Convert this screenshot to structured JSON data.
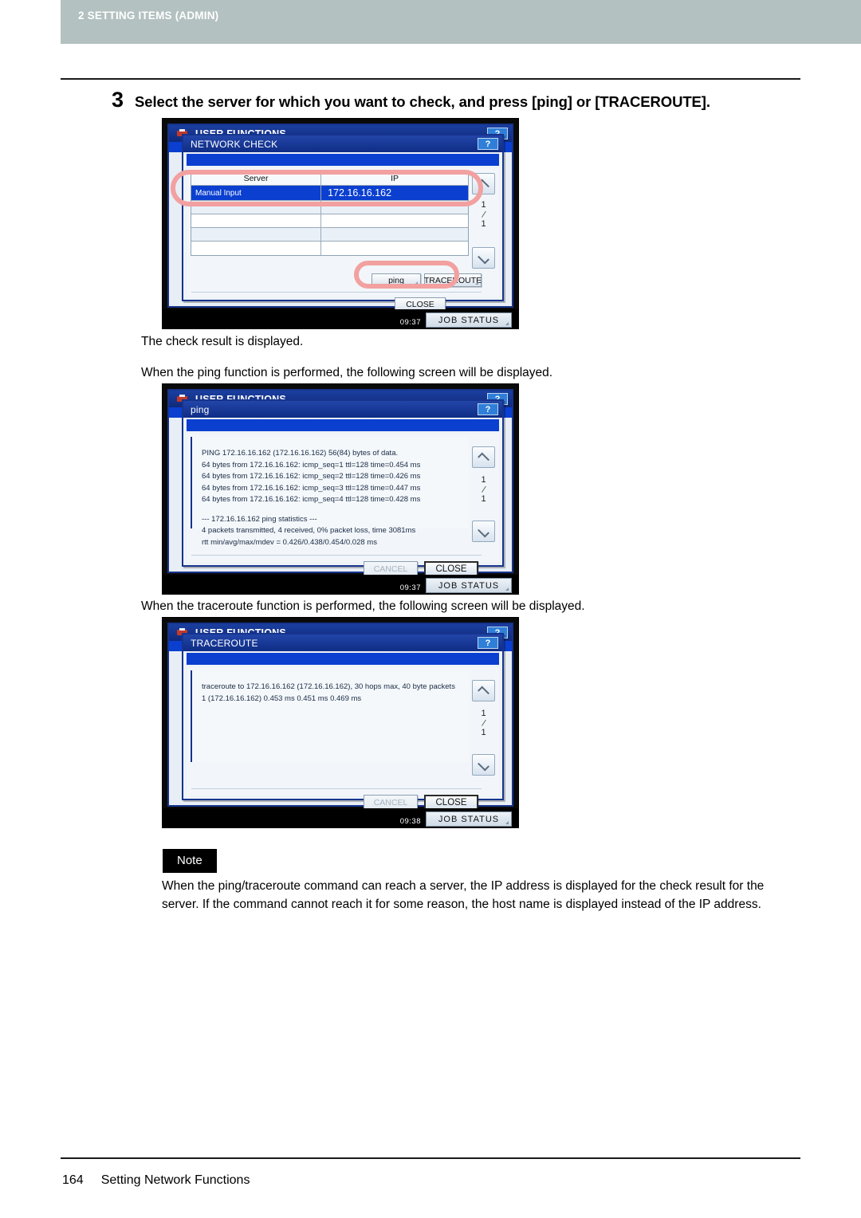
{
  "header": {
    "running_head": "2 SETTING ITEMS (ADMIN)"
  },
  "step": {
    "number": "3",
    "text": "Select the server for which you want to check, and press [ping] or [TRACEROUTE]."
  },
  "paragraphs": {
    "after_step1": "The check result is displayed.",
    "before_ping": "When the ping function is performed, the following screen will be displayed.",
    "before_traceroute": "When the traceroute function is performed, the following screen will be displayed."
  },
  "screens": {
    "network_check": {
      "app_title": "USER FUNCTIONS",
      "help_label": "?",
      "dialog_title": "NETWORK CHECK",
      "table": {
        "columns": [
          "Server",
          "IP"
        ],
        "rows": [
          {
            "server": "Manual Input",
            "ip": "172.16.16.162",
            "selected": true
          },
          {
            "server": "",
            "ip": "",
            "selected": false
          },
          {
            "server": "",
            "ip": "",
            "selected": false
          },
          {
            "server": "",
            "ip": "",
            "selected": false
          },
          {
            "server": "",
            "ip": "",
            "selected": false
          }
        ]
      },
      "pager": {
        "current": "1",
        "total": "1"
      },
      "buttons": {
        "ping": "ping",
        "traceroute": "TRACEROUTE",
        "close": "CLOSE"
      },
      "status_bar": {
        "clock": "09:37",
        "job_status": "JOB STATUS"
      }
    },
    "ping": {
      "app_title": "USER FUNCTIONS",
      "help_label": "?",
      "dialog_title": "ping",
      "log": [
        "PING 172.16.16.162 (172.16.16.162) 56(84) bytes of data.",
        "64 bytes from 172.16.16.162: icmp_seq=1 ttl=128 time=0.454 ms",
        "64 bytes from 172.16.16.162: icmp_seq=2 ttl=128 time=0.426 ms",
        "64 bytes from 172.16.16.162: icmp_seq=3 ttl=128 time=0.447 ms",
        "64 bytes from 172.16.16.162: icmp_seq=4 ttl=128 time=0.428 ms",
        "",
        "--- 172.16.16.162 ping statistics ---",
        "4 packets transmitted, 4 received, 0% packet loss, time 3081ms",
        "rtt min/avg/max/mdev = 0.426/0.438/0.454/0.028 ms"
      ],
      "pager": {
        "current": "1",
        "total": "1"
      },
      "buttons": {
        "cancel": "CANCEL",
        "close": "CLOSE"
      },
      "status_bar": {
        "clock": "09:37",
        "job_status": "JOB STATUS"
      }
    },
    "traceroute": {
      "app_title": "USER FUNCTIONS",
      "help_label": "?",
      "dialog_title": "TRACEROUTE",
      "log": [
        "traceroute to 172.16.16.162 (172.16.16.162), 30 hops max, 40 byte packets",
        " 1  (172.16.16.162)  0.453 ms  0.451 ms  0.469 ms"
      ],
      "pager": {
        "current": "1",
        "total": "1"
      },
      "buttons": {
        "cancel": "CANCEL",
        "close": "CLOSE"
      },
      "status_bar": {
        "clock": "09:38",
        "job_status": "JOB STATUS"
      }
    }
  },
  "note": {
    "label": "Note",
    "line1": "When the ping/traceroute command can reach a server, the IP address is displayed for the check result for the",
    "line2": "server. If the command cannot reach it for some reason, the host name is displayed instead of the IP address."
  },
  "footer": {
    "page_number": "164",
    "title": "Setting Network Functions"
  },
  "colors": {
    "header_band": "#b3c1c0",
    "title_bar": "#16348c",
    "selection": "#0a3fd0",
    "highlight_ellipse": "#f2a0a0"
  }
}
